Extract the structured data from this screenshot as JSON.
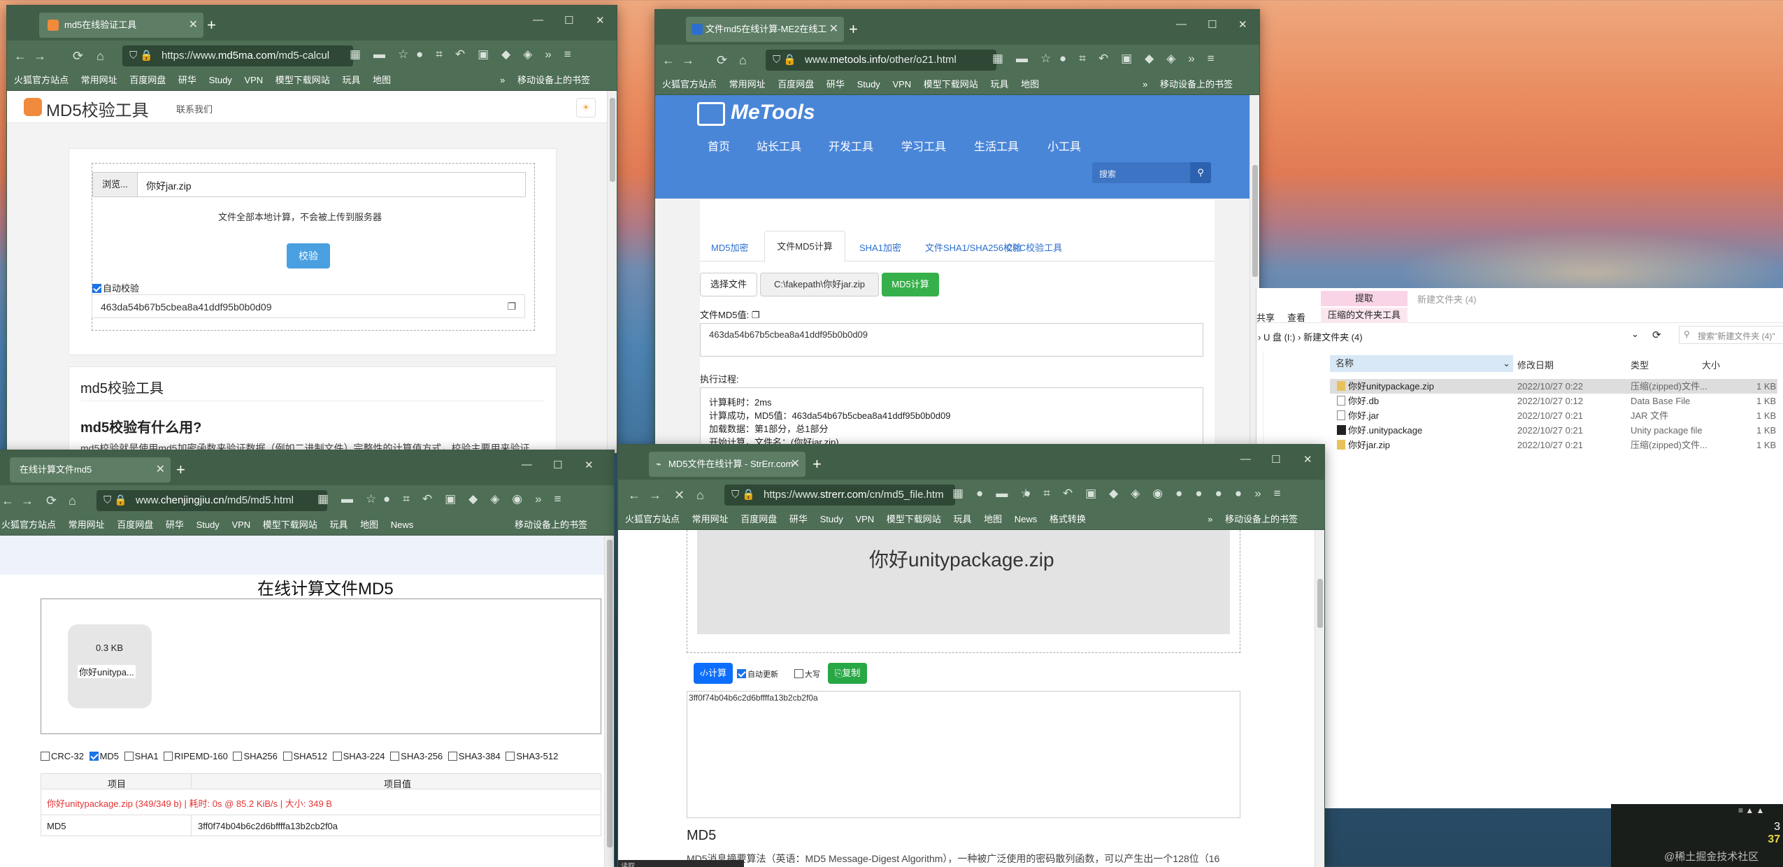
{
  "common": {
    "bookmarks": [
      "火狐官方站点",
      "常用网址",
      "百度网盘",
      "研华",
      "Study",
      "VPN",
      "模型下载网站",
      "玩具",
      "地图"
    ],
    "bookmarks_extra_news": "News",
    "bookmarks_extra_format": "格式转换",
    "mobile_bookmarks": "移动设备上的书签",
    "more_chevron": "»"
  },
  "win1": {
    "tab_title": "md5在线验证工具",
    "url_prefix": "https://www.",
    "url_domain": "md5ma.com",
    "url_path": "/md5-calcul",
    "logo_text": "MD5校验工具",
    "contact": "联系我们",
    "browse_label": "浏览...",
    "file_name": "你好jar.zip",
    "local_note": "文件全部本地计算，不会被上传到服务器",
    "verify_button": "校验",
    "auto_verify": "自动校验",
    "md5_value": "463da54b67b5cbea8a41ddf95b0b0d09",
    "section_title": "md5校验工具",
    "question": "md5校验有什么用?",
    "paragraph": "md5校验就是使用md5加密函数来验证数据（例如二进制文件）完整性的计算值方式，校验主要用来验证"
  },
  "win2": {
    "tab_title": "文件md5在线计算-ME2在线工",
    "url_prefix": "www.",
    "url_domain": "metools.info",
    "url_path": "/other/o21.html",
    "logo_text": "MeTools",
    "nav": [
      "首页",
      "站长工具",
      "开发工具",
      "学习工具",
      "生活工具",
      "小工具"
    ],
    "search_placeholder": "搜索",
    "subtabs": [
      "MD5加密",
      "文件MD5计算",
      "SHA1加密",
      "文件SHA1/SHA256校验",
      "CRC校验工具"
    ],
    "choose_file": "选择文件",
    "file_path": "C:\\fakepath\\你好jar.zip",
    "calc_button": "MD5计算",
    "md5_label": "文件MD5值:",
    "md5_value": "463da54b67b5cbea8a41ddf95b0b0d09",
    "process_label": "执行过程:",
    "process_lines": [
      "计算耗时：2ms",
      "计算成功，MD5值：463da54b67b5cbea8a41ddf95b0b0d09",
      "加载数据：第1部分，总1部分",
      "开始计算，文件名：(你好jar.zip)"
    ]
  },
  "win3": {
    "tab_title": "在线计算文件md5",
    "url_prefix": "www.",
    "url_domain": "chenjingjiu.cn",
    "url_path": "/md5/md5.html",
    "page_title": "在线计算文件MD5",
    "file_size": "0.3 KB",
    "file_name": "你好unitypa...",
    "hash_options": [
      "CRC-32",
      "MD5",
      "SHA1",
      "RIPEMD-160",
      "SHA256",
      "SHA512",
      "SHA3-224",
      "SHA3-256",
      "SHA3-384",
      "SHA3-512"
    ],
    "col_item": "项目",
    "col_value": "项目值",
    "result_summary": "你好unitypackage.zip (349/349 b) | 耗时: 0s @ 85.2 KiB/s | 大小: 349 B",
    "row_label": "MD5",
    "row_value": "3ff0f74b04b6c2d6bffffa13b2cb2f0a"
  },
  "win4": {
    "tab_title": "MD5文件在线计算 - StrErr.com",
    "url_prefix": "https://www.",
    "url_domain": "strerr.com",
    "url_path": "/cn/md5_file.htm",
    "drop_file": "你好unitypackage.zip",
    "calc_button": "计算",
    "auto_update": "自动更新",
    "uppercase": "大写",
    "copy_button": "复制",
    "result": "3ff0f74b04b6c2d6bffffa13b2cb2f0a",
    "heading": "MD5",
    "paragraph": "MD5消息摘要算法（英语：MD5 Message-Digest Algorithm），一种被广泛使用的密码散列函数，可以产生出一个128位（16",
    "status": "读取"
  },
  "explorer": {
    "ribbon_extract": "提取",
    "folder_title": "新建文件夹 (4)",
    "ribbon_share": "共享",
    "ribbon_view": "查看",
    "ribbon_tools": "压缩的文件夹工具",
    "path_drive": "U 盘 (I:)",
    "path_sep": "›",
    "path_folder": "新建文件夹 (4)",
    "search_placeholder": "搜索\"新建文件夹 (4)\"",
    "col_name": "名称",
    "col_date": "修改日期",
    "col_type": "类型",
    "col_size": "大小",
    "files": [
      {
        "name": "你好unitypackage.zip",
        "date": "2022/10/27 0:22",
        "type": "压缩(zipped)文件...",
        "size": "1 KB"
      },
      {
        "name": "你好.db",
        "date": "2022/10/27 0:12",
        "type": "Data Base File",
        "size": "1 KB"
      },
      {
        "name": "你好.jar",
        "date": "2022/10/27 0:21",
        "type": "JAR 文件",
        "size": "1 KB"
      },
      {
        "name": "你好.unitypackage",
        "date": "2022/10/27 0:21",
        "type": "Unity package file",
        "size": "1 KB"
      },
      {
        "name": "你好jar.zip",
        "date": "2022/10/27 0:21",
        "type": "压缩(zipped)文件...",
        "size": "1 KB"
      }
    ]
  },
  "taskbar": {
    "num1": "3",
    "num2": "37",
    "label": "@稀土掘金技术社区"
  },
  "colors": {
    "firefox_frame": "#415f48",
    "firefox_nav": "#4e6e56",
    "metools_blue": "#4a86d8",
    "strerr_blue": "#0d6efd",
    "strerr_green": "#28a745",
    "md5ma_button": "#4a9fe0"
  }
}
